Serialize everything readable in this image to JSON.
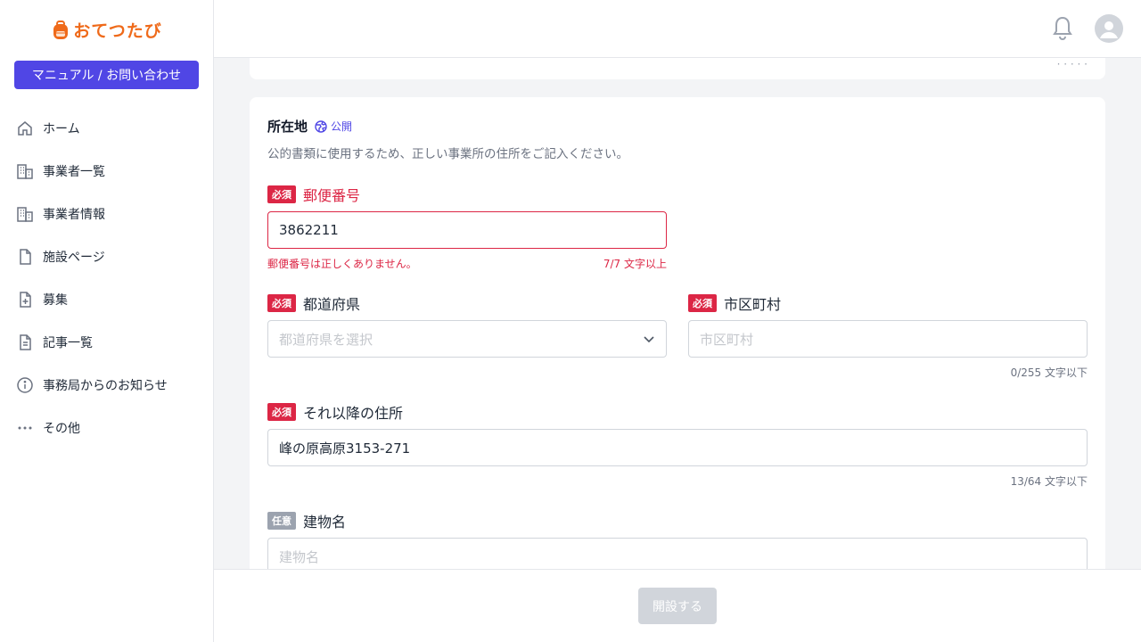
{
  "app": {
    "logo_text": "おてつたび"
  },
  "sidebar": {
    "manual_button": "マニュアル / お問い合わせ",
    "items": [
      {
        "label": "ホーム",
        "icon": "home-icon"
      },
      {
        "label": "事業者一覧",
        "icon": "building-icon"
      },
      {
        "label": "事業者情報",
        "icon": "building-icon"
      },
      {
        "label": "施設ページ",
        "icon": "document-icon"
      },
      {
        "label": "募集",
        "icon": "document-plus-icon"
      },
      {
        "label": "記事一覧",
        "icon": "document-text-icon"
      },
      {
        "label": "事務局からのお知らせ",
        "icon": "info-circle-icon"
      },
      {
        "label": "その他",
        "icon": "more-dots-icon"
      }
    ]
  },
  "header": {
    "icons": [
      "bell-icon",
      "user-avatar-icon"
    ]
  },
  "section": {
    "title": "所在地",
    "visibility": "公開",
    "description": "公的書類に使用するため、正しい事業所の住所をご記入ください。"
  },
  "badges": {
    "required": "必須",
    "optional": "任意"
  },
  "fields": {
    "postal": {
      "label": "郵便番号",
      "value": "3862211",
      "error": "郵便番号は正しくありません。",
      "counter": "7/7 文字以上"
    },
    "prefecture": {
      "label": "都道府県",
      "placeholder": "都道府県を選択"
    },
    "city": {
      "label": "市区町村",
      "placeholder": "市区町村",
      "counter": "0/255 文字以下"
    },
    "address": {
      "label": "それ以降の住所",
      "value": "峰の原高原3153-271",
      "counter": "13/64 文字以下"
    },
    "building": {
      "label": "建物名",
      "placeholder": "建物名"
    }
  },
  "footer": {
    "submit_label": "開設する"
  },
  "colors": {
    "primary": "#5046e5",
    "brand": "#ef6a1a",
    "error": "#dc2645",
    "muted_badge": "#9ca3af",
    "disabled_button": "#d1d5db"
  }
}
